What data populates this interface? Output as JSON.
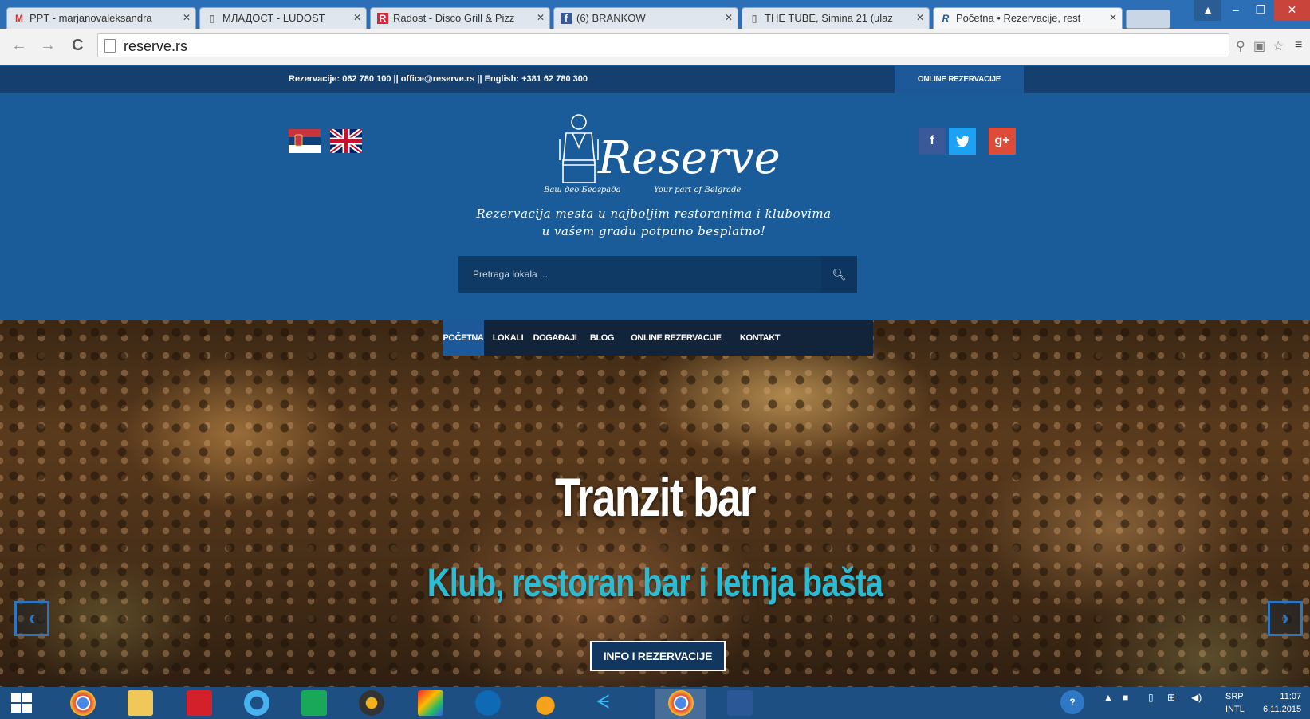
{
  "browser": {
    "tabs": [
      {
        "title": "PPT - marjanovaleksandra",
        "icon": "gmail-icon",
        "active": false
      },
      {
        "title": "МЛАДОСТ - LUDOST",
        "icon": "page-icon",
        "active": false
      },
      {
        "title": "Radost - Disco Grill & Pizz",
        "icon": "radost-icon",
        "active": false
      },
      {
        "title": "(6) BRANKOW",
        "icon": "facebook-icon",
        "active": false
      },
      {
        "title": "THE TUBE, Simina 21 (ulaz",
        "icon": "page-icon",
        "active": false
      },
      {
        "title": "Početna • Rezervacije, rest",
        "icon": "reserve-icon",
        "active": true
      }
    ],
    "url": "reserve.rs"
  },
  "site": {
    "topbar_info": "Rezervacije: 062 780 100 || office@reserve.rs || English: +381 62 780 300",
    "topbar_button": "ONLINE REZERVACIJE",
    "logo_text": "Reserve",
    "logo_sub_left": "Ваш део Београда",
    "logo_sub_right": "Your part of Belgrade",
    "tagline_line1": "Rezervacija mesta u najboljim restoranima i klubovima",
    "tagline_line2": "u vašem gradu potpuno besplatno!",
    "search_placeholder": "Pretraga lokala ...",
    "nav": [
      "POČETNA",
      "LOKALI",
      "DOGAĐAJI",
      "BLOG",
      "ONLINE REZERVACIJE",
      "KONTAKT"
    ],
    "social": {
      "facebook": "f",
      "twitter": "t",
      "googleplus": "g+"
    },
    "hero_title": "Tranzit bar",
    "hero_subtitle": "Klub, restoran bar i letnja bašta",
    "hero_button": "INFO I REZERVACIJE"
  },
  "taskbar": {
    "language": "SRP",
    "layout": "INTL",
    "time": "11:07",
    "date": "6.11.2015"
  },
  "colors": {
    "header_blue": "#1a5b99",
    "topbar_navy": "#143f6e",
    "accent_cyan": "#2bbcd4",
    "nav_active": "#1d5899"
  }
}
